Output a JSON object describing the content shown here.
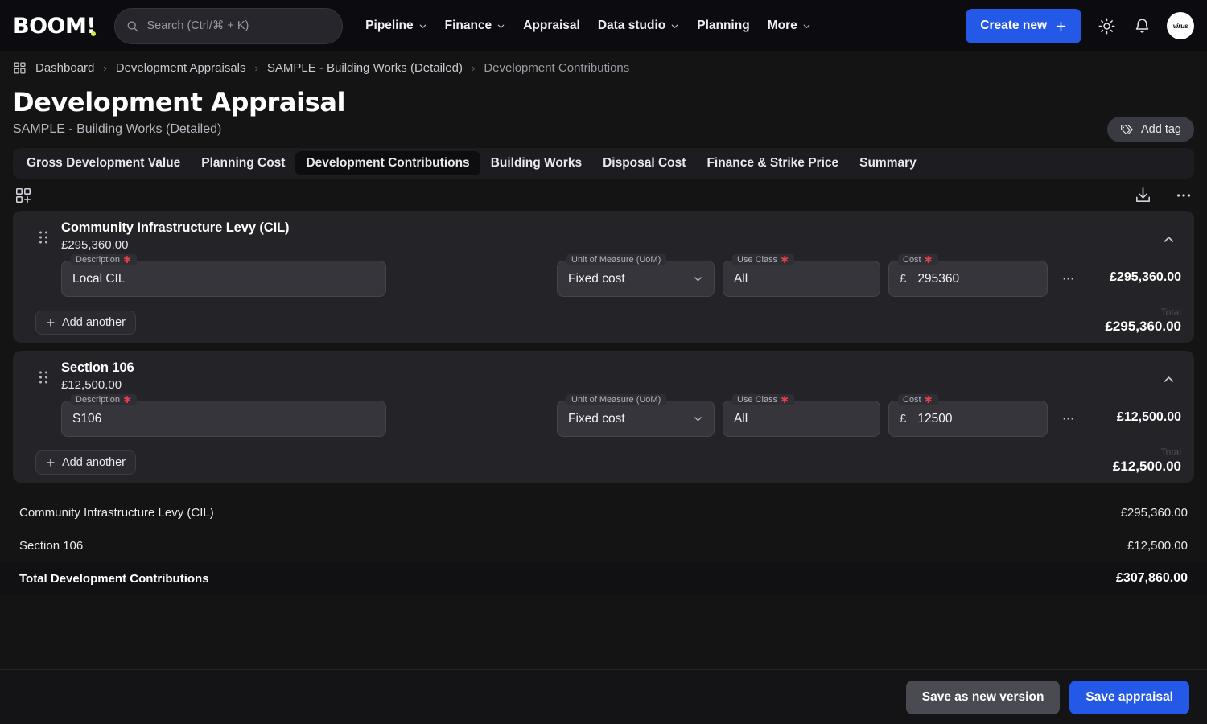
{
  "brand": {
    "logo": "BOOM!",
    "accent": "#2458e6",
    "logo_dot": "#c7f04a"
  },
  "search": {
    "placeholder": "Search (Ctrl/⌘ + K)",
    "value": "",
    "icon": "search-icon"
  },
  "nav": [
    {
      "label": "Pipeline",
      "has_menu": true
    },
    {
      "label": "Finance",
      "has_menu": true
    },
    {
      "label": "Appraisal",
      "has_menu": false
    },
    {
      "label": "Data studio",
      "has_menu": true
    },
    {
      "label": "Planning",
      "has_menu": false
    },
    {
      "label": "More",
      "has_menu": true
    }
  ],
  "topright": {
    "create_label": "Create new",
    "theme_icon": "sun-icon",
    "notifications_icon": "bell-icon",
    "avatar_text": "virus"
  },
  "breadcrumb": {
    "home_icon": "dashboard-grid-icon",
    "items": [
      {
        "label": "Dashboard"
      },
      {
        "label": "Development Appraisals"
      },
      {
        "label": "SAMPLE - Building Works (Detailed)"
      },
      {
        "label": "Development Contributions"
      }
    ],
    "separator": "›"
  },
  "page": {
    "title": "Development Appraisal",
    "subtitle": "SAMPLE - Building Works (Detailed)",
    "add_tag_label": "Add tag",
    "add_tag_icon": "tags-icon"
  },
  "tabs": [
    {
      "label": "Gross Development Value",
      "active": false
    },
    {
      "label": "Planning Cost",
      "active": false
    },
    {
      "label": "Development Contributions",
      "active": true
    },
    {
      "label": "Building Works",
      "active": false
    },
    {
      "label": "Disposal Cost",
      "active": false
    },
    {
      "label": "Finance & Strike Price",
      "active": false
    },
    {
      "label": "Summary",
      "active": false
    }
  ],
  "toolbar": {
    "add_block_icon": "grid-plus-icon",
    "download_icon": "download-icon",
    "more_icon": "ellipsis-icon"
  },
  "field_labels": {
    "description": "Description",
    "uom": "Unit of Measure (UoM)",
    "use_class": "Use Class",
    "cost": "Cost",
    "currency": "£",
    "required_mark": "✱",
    "total": "Total",
    "add_another": "Add another"
  },
  "cards": [
    {
      "title": "Community Infrastructure Levy (CIL)",
      "amount": "£295,360.00",
      "collapse_icon": "chevron-up-icon",
      "rows": [
        {
          "description": "Local CIL",
          "uom": "Fixed cost",
          "use_class": "All",
          "cost": "295360",
          "row_total": "£295,360.00"
        }
      ],
      "total": "£295,360.00"
    },
    {
      "title": "Section 106",
      "amount": "£12,500.00",
      "collapse_icon": "chevron-up-icon",
      "rows": [
        {
          "description": "S106",
          "uom": "Fixed cost",
          "use_class": "All",
          "cost": "12500",
          "row_total": "£12,500.00"
        }
      ],
      "total": "£12,500.00"
    }
  ],
  "summary": [
    {
      "label": "Community Infrastructure Levy (CIL)",
      "value": "£295,360.00",
      "is_total": false
    },
    {
      "label": "Section 106",
      "value": "£12,500.00",
      "is_total": false
    },
    {
      "label": "Total Development Contributions",
      "value": "£307,860.00",
      "is_total": true
    }
  ],
  "footer": {
    "save_version_label": "Save as new version",
    "save_label": "Save appraisal"
  }
}
